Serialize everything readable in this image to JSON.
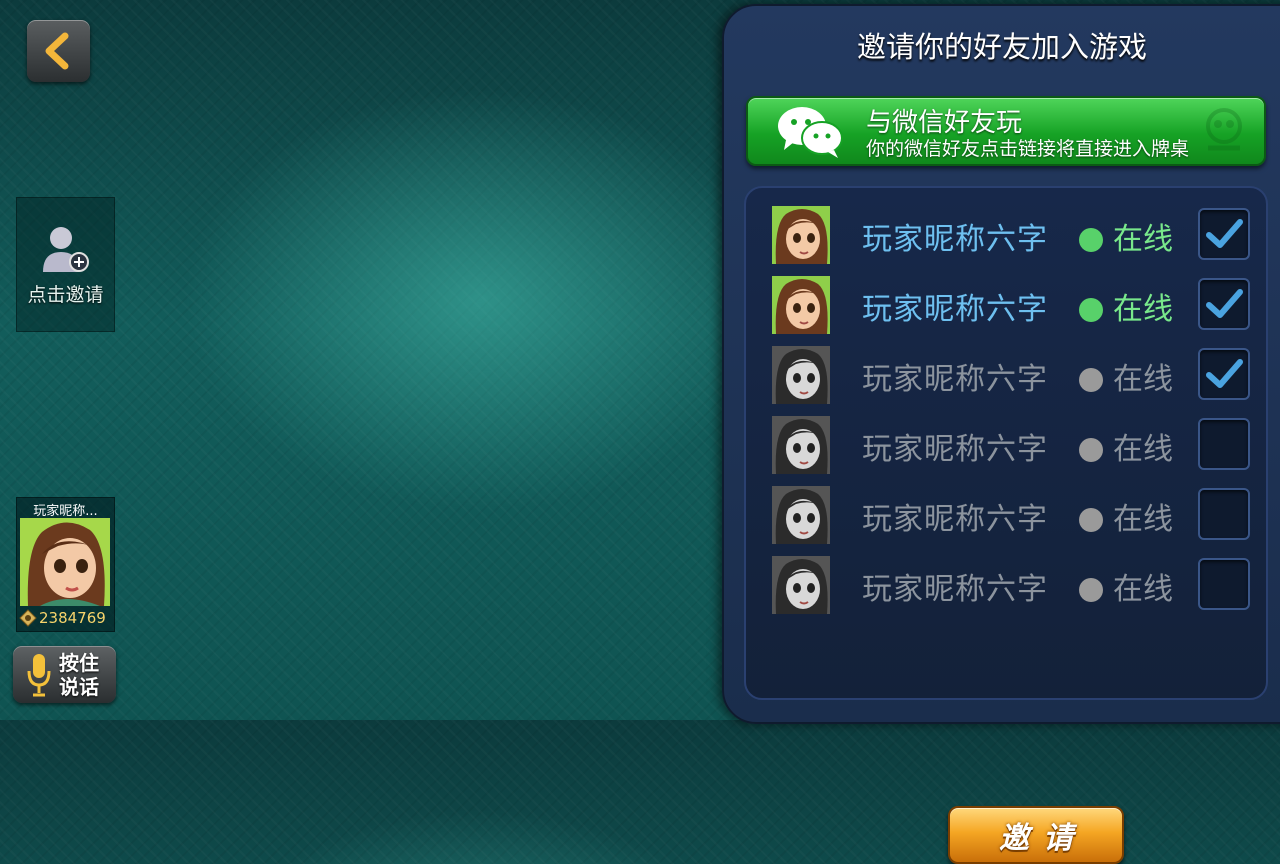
{
  "left": {
    "back_icon": "chevron-left-icon",
    "invite_slot": {
      "icon": "add-user-icon",
      "label": "点击邀请"
    },
    "self_player": {
      "name": "玩家昵称...",
      "coin_icon": "coin-icon",
      "coins": "2384769"
    },
    "voice": {
      "icon": "microphone-icon",
      "label_line1": "按住",
      "label_line2": "说话"
    }
  },
  "panel": {
    "title": "邀请你的好友加入游戏",
    "wechat": {
      "icon": "wechat-icon",
      "title": "与微信好友玩",
      "subtitle": "你的微信好友点击链接将直接进入牌桌"
    },
    "friends": [
      {
        "name": "玩家昵称六字",
        "status": "在线",
        "online": true,
        "checked": true
      },
      {
        "name": "玩家昵称六字",
        "status": "在线",
        "online": true,
        "checked": true
      },
      {
        "name": "玩家昵称六字",
        "status": "在线",
        "online": false,
        "checked": true
      },
      {
        "name": "玩家昵称六字",
        "status": "在线",
        "online": false,
        "checked": false
      },
      {
        "name": "玩家昵称六字",
        "status": "在线",
        "online": false,
        "checked": false
      },
      {
        "name": "玩家昵称六字",
        "status": "在线",
        "online": false,
        "checked": false
      }
    ],
    "invite_button": "邀请"
  },
  "colors": {
    "online_text": "#79e88b",
    "online_name": "#6ec0f0",
    "offline": "#8c949e",
    "check": "#4aa3e0"
  }
}
